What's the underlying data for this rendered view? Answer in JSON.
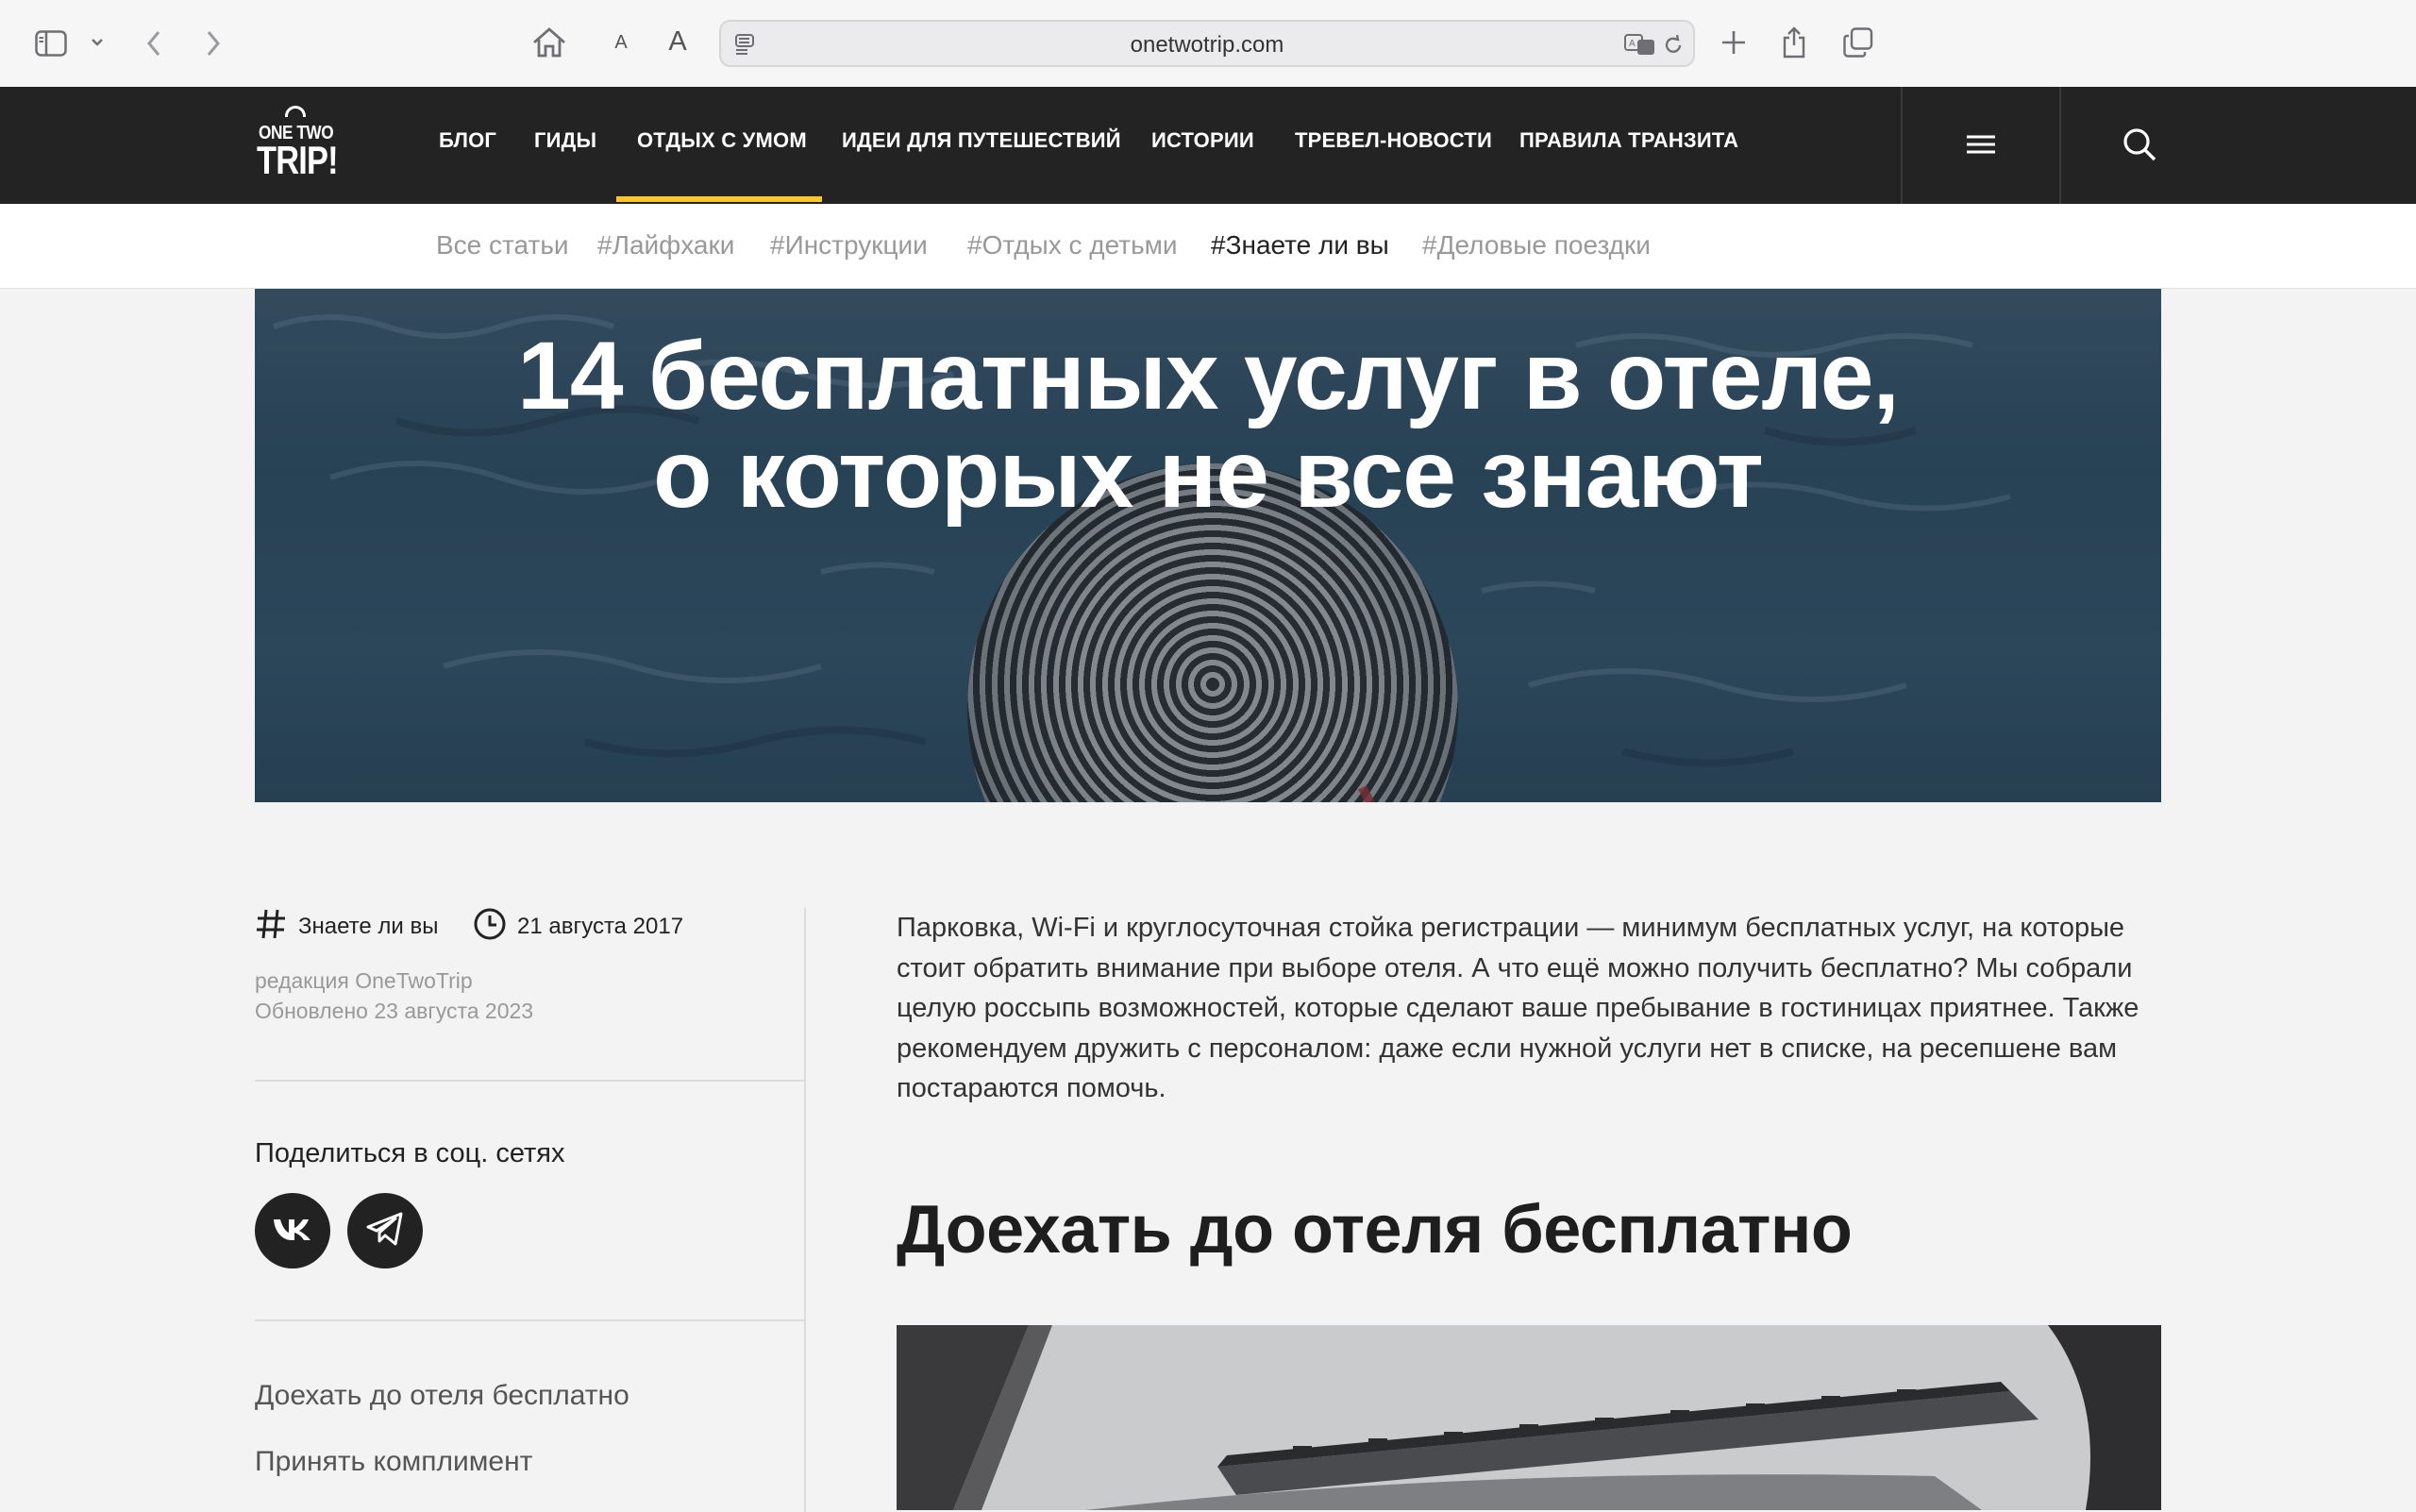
{
  "browser": {
    "url": "onetwotrip.com",
    "font_small": "A",
    "font_large": "A"
  },
  "site": {
    "logo_top": "ONE TWO",
    "logo_bottom": "TRIP!",
    "nav": [
      "БЛОГ",
      "ГИДЫ",
      "ОТДЫХ С УМОМ",
      "ИДЕИ ДЛЯ ПУТЕШЕСТВИЙ",
      "ИСТОРИИ",
      "ТРЕВЕЛ-НОВОСТИ",
      "ПРАВИЛА ТРАНЗИТА"
    ],
    "nav_active": "ОТДЫХ С УМОМ",
    "accent": "#ffc629",
    "nav_bg": "#232323"
  },
  "subnav": {
    "items": [
      "Все статьи",
      "#Лайфхаки",
      "#Инструкции",
      "#Отдых с детьми",
      "#Знаете ли вы",
      "#Деловые поездки"
    ],
    "active": "#Знаете ли вы"
  },
  "hero": {
    "title_line1": "14 бесплатных услуг в отеле,",
    "title_line2": "о которых не все знают"
  },
  "meta": {
    "tag": "Знаете ли вы",
    "date": "21 августа 2017",
    "author": "редакция OneTwoTrip",
    "updated": "Обновлено 23 августа 2023"
  },
  "share": {
    "title": "Поделиться в соц. сетях",
    "networks": [
      "vk",
      "telegram"
    ]
  },
  "toc": [
    "Доехать до отеля бесплатно",
    "Принять комплимент"
  ],
  "article": {
    "lead": "Парковка, Wi-Fi и круглосуточная стойка регистрации — минимум бесплатных услуг, на которые стоит обратить внимание при выборе отеля. А что ещё можно получить бесплатно? Мы собрали целую россыпь возможностей, которые сделают ваше пребывание в гостиницах приятнее. Также рекомендуем дружить с персоналом: даже если нужной услуги нет в списке, на ресепшене вам постараются помочь.",
    "h2": "Доехать до отеля бесплатно"
  }
}
